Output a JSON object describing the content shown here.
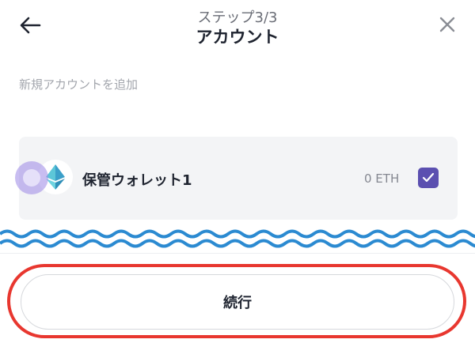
{
  "header": {
    "step": "ステップ3/3",
    "title": "アカウント",
    "back_icon": "arrow-left-icon",
    "close_icon": "close-icon"
  },
  "add_account_label": "新規アカウントを追加",
  "wallet": {
    "name": "保管ウォレット1",
    "balance": "0 ETH",
    "icon": "ethereum-icon",
    "selected": true
  },
  "footer": {
    "continue_label": "続行"
  },
  "colors": {
    "accent": "#5b4fb0",
    "wave": "#2b8ad1",
    "highlight": "#e8372f",
    "card_bg": "#f3f4f6"
  }
}
